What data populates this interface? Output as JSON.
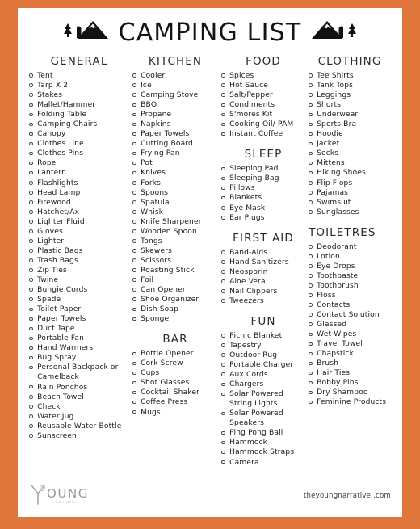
{
  "theme": {
    "border_color": "#e0763c",
    "page_color": "#ffffff",
    "text_color": "#1b1b1b"
  },
  "header": {
    "title": "CAMPING LIST",
    "left_icon": "mountains-trees-icon",
    "right_icon": "mountains-trees-icon"
  },
  "columns": [
    {
      "key": "general",
      "sections": [
        {
          "heading": "GENERAL",
          "align": "center",
          "items": [
            "Tent",
            "Tarp X 2",
            "Stakes",
            "Mallet/Hammer",
            "Folding Table",
            "Camping Chairs",
            "Canopy",
            "Clothes Line",
            "Clothes Pins",
            "Rope",
            "Lantern",
            "Flashlights",
            "Head Lamp",
            "Firewood",
            "Hatchet/Ax",
            "Lighter Fluid",
            "Gloves",
            "Lighter",
            "Plastic Bags",
            "Trash Bags",
            "Zip Ties",
            "Twine",
            "Bungie Cords",
            "Spade",
            "Toilet Paper",
            "Paper Towels",
            "Duct Tape",
            "Portable Fan",
            "Hand Warmers",
            "Bug Spray",
            "Personal Backpack or Camelback",
            "Rain Ponchos",
            "Beach Towel",
            "Check",
            "Water Jug",
            "Reusable Water Bottle",
            "Sunscreen"
          ]
        }
      ]
    },
    {
      "key": "kitchen",
      "sections": [
        {
          "heading": "KITCHEN",
          "align": "center",
          "items": [
            "Cooler",
            "Ice",
            "Camping Stove",
            "BBQ",
            "Propane",
            "Napkins",
            "Paper Towels",
            "Cutting Board",
            "Frying Pan",
            "Pot",
            "Knives",
            "Forks",
            "Spoons",
            "Spatula",
            "Whisk",
            "Knife Sharpener",
            "Wooden Spoon",
            "Tongs",
            "Skewers",
            "Scissors",
            "Roasting Stick",
            "Foil",
            "Can Opener",
            "Shoe Organizer",
            "Dish Soap",
            "Sponge"
          ]
        },
        {
          "heading": "BAR",
          "align": "center",
          "items": [
            "Bottle Opener",
            "Cork Screw",
            "Cups",
            "Shot Glasses",
            "Cocktail Shaker",
            "Coffee Press",
            "Mugs"
          ]
        }
      ]
    },
    {
      "key": "food",
      "sections": [
        {
          "heading": "FOOD",
          "align": "center",
          "items": [
            "Spices",
            "Hot Sauce",
            "Salt/Pepper",
            "Condiments",
            "S'mores Kit",
            "Cooking Oil/ PAM",
            "Instant Coffee"
          ]
        },
        {
          "heading": "SLEEP",
          "align": "center",
          "items": [
            "Sleeping Pad",
            "Sleeping Bag",
            "Pillows",
            "Blankets",
            "Eye Mask",
            "Ear Plugs"
          ]
        },
        {
          "heading": "FIRST AID",
          "align": "center",
          "items": [
            "Band-Aids",
            "Hand Sanitizers",
            "Neosporin",
            "Aloe Vera",
            "Nail Clippers",
            "Tweezers"
          ]
        },
        {
          "heading": "FUN",
          "align": "center",
          "items": [
            "Picnic Blanket",
            "Tapestry",
            "Outdoor Rug",
            "Portable Charger",
            "Aux Cords",
            "Chargers",
            "Solar Powered String Lights",
            "Solar Powered Speakers",
            "Ping Pong Ball",
            "Hammock",
            "Hammock Straps",
            "Camera"
          ]
        }
      ]
    },
    {
      "key": "clothing",
      "sections": [
        {
          "heading": "CLOTHING",
          "align": "center",
          "items": [
            "Tee Shirts",
            "Tank Tops",
            "Leggings",
            "Shorts",
            "Underwear",
            "Sports Bra",
            "Hoodie",
            "Jacket",
            "Socks",
            "Mittens",
            "Hiking Shoes",
            "Flip Flops",
            "Pajamas",
            "Swimsuit",
            "Sunglasses"
          ]
        },
        {
          "heading": "TOILETRES",
          "align": "left",
          "items": [
            "Deodorant",
            "Lotion",
            "Eye Drops",
            "Toothpaste",
            "Toothbrush",
            "Floss",
            "Contacts",
            "Contact Solution",
            "Glassed",
            "Wet Wipes",
            "Travel Towel",
            "Chapstick",
            "Brush",
            "Hair Ties",
            "Bobby Pins",
            "Dry Shampoo",
            "Feminine Products"
          ]
        }
      ]
    }
  ],
  "footer": {
    "logo_main": "OUNG",
    "logo_sub": "narrative",
    "site": "theyoungnarrative .com"
  }
}
